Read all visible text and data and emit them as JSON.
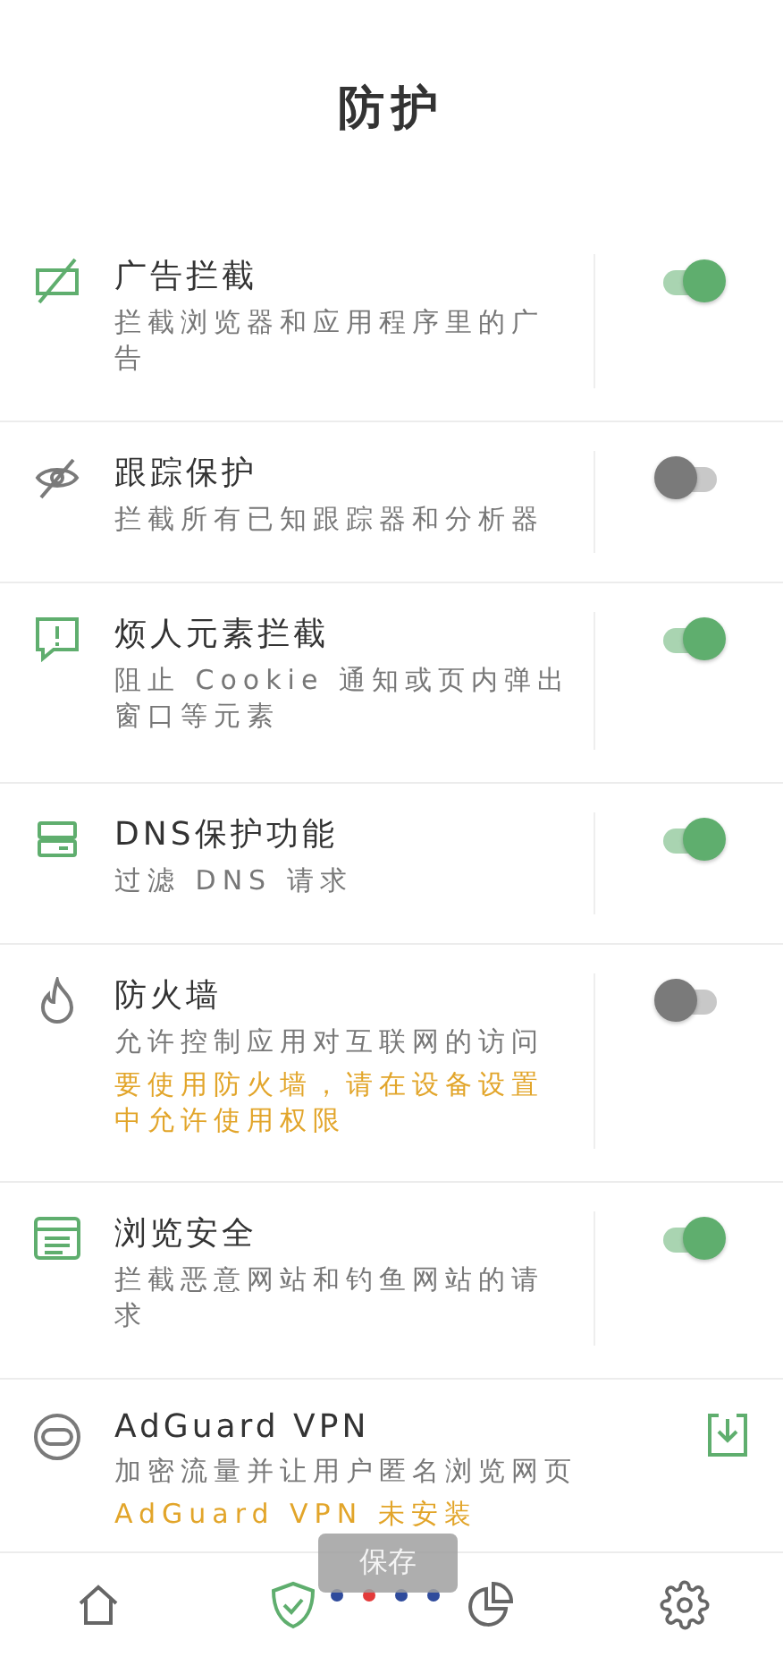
{
  "title": "防护",
  "features": [
    {
      "kind": "toggle",
      "title": "广告拦截",
      "description": "拦截浏览器和应用程序里的广告",
      "on": true
    },
    {
      "kind": "toggle",
      "title": "跟踪保护",
      "description": "拦截所有已知跟踪器和分析器",
      "on": false
    },
    {
      "kind": "toggle",
      "title": "烦人元素拦截",
      "description": "阻止 Cookie 通知或页内弹出窗口等元素",
      "on": true
    },
    {
      "kind": "toggle",
      "title": "DNS保护功能",
      "description": "过滤 DNS 请求",
      "on": true
    },
    {
      "kind": "toggle",
      "title": "防火墙",
      "description": "允许控制应用对互联网的访问",
      "warning": "要使用防火墙，请在设备设置中允许使用权限",
      "on": false
    },
    {
      "kind": "toggle",
      "title": "浏览安全",
      "description": "拦截恶意网站和钓鱼网站的请求",
      "on": true
    },
    {
      "kind": "install",
      "title": "AdGuard VPN",
      "description": "加密流量并让用户匿名浏览网页",
      "warning": "AdGuard VPN 未安装",
      "on": false
    }
  ],
  "toast": "保存",
  "page_dots": [
    {
      "selected": false
    },
    {
      "selected": true
    },
    {
      "selected": false
    },
    {
      "selected": false
    }
  ],
  "nav": [
    {
      "selected": false
    },
    {
      "selected": true
    },
    {
      "selected": false
    },
    {
      "selected": false
    }
  ]
}
